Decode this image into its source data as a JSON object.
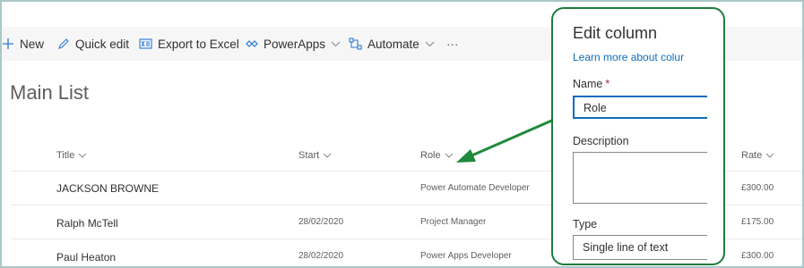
{
  "command_bar": {
    "new_label": "New",
    "quick_edit_label": "Quick edit",
    "export_label": "Export to Excel",
    "powerapps_label": "PowerApps",
    "automate_label": "Automate",
    "more_label": "···"
  },
  "list": {
    "title": "Main List",
    "columns": [
      "Title",
      "Start",
      "Role",
      "Rate"
    ],
    "rows": [
      {
        "title": "JACKSON BROWNE",
        "start": "",
        "role": "Power Automate Developer",
        "rate": "£300.00"
      },
      {
        "title": "Ralph McTell",
        "start": "28/02/2020",
        "role": "Project Manager",
        "rate": "£175.00"
      },
      {
        "title": "Paul Heaton",
        "start": "28/02/2020",
        "role": "Power Apps Developer",
        "rate": "£300.00"
      }
    ]
  },
  "edit_panel": {
    "title": "Edit column",
    "learn_more_link": "Learn more about colur",
    "name_label": "Name",
    "required_mark": "*",
    "name_value": "Role",
    "description_label": "Description",
    "type_label": "Type",
    "type_value": "Single line of text"
  },
  "colors": {
    "accent_blue": "#2b7bd6",
    "panel_border_green": "#1e7c3c",
    "annotation_arrow_green": "#1f8a3c",
    "frame_border": "#a9c7c7"
  }
}
